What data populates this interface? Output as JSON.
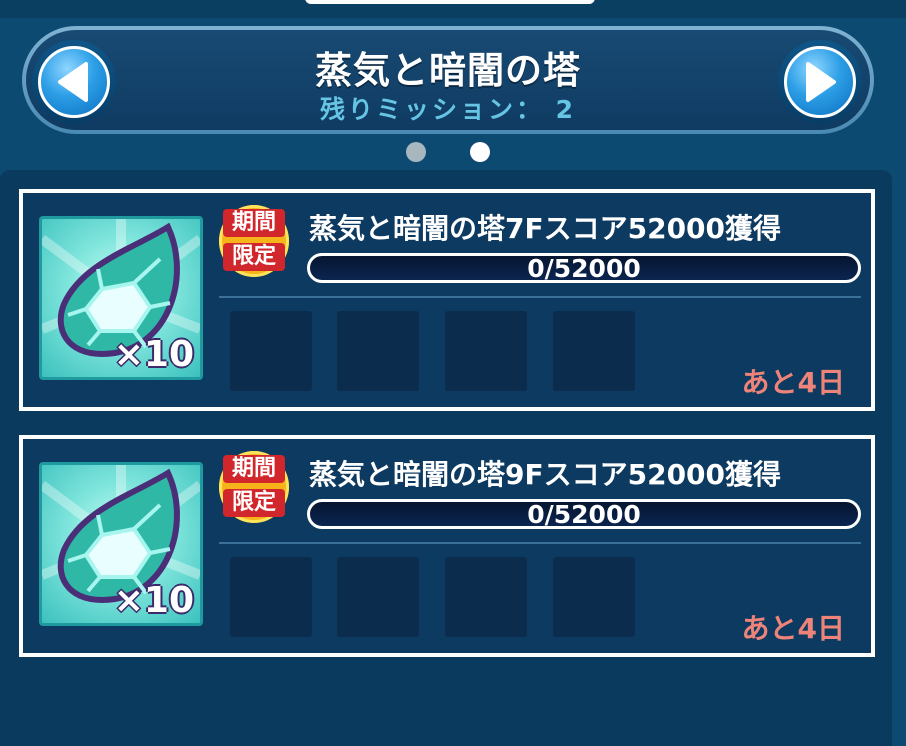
{
  "header": {
    "title": "蒸気と暗闇の塔",
    "subtitle": "残りミッション： 2",
    "prev_icon": "left-triangle-icon",
    "next_icon": "right-triangle-icon"
  },
  "pagination": {
    "pages": 2,
    "current": 2
  },
  "missions": [
    {
      "badge_line1": "期間",
      "badge_line2": "限定",
      "text": "蒸気と暗闇の塔7Fスコア52000獲得",
      "progress_text": "0/52000",
      "progress": 0,
      "reward_icon": "leaf-gem-icon",
      "reward_count": "×10",
      "remaining": "あと4日"
    },
    {
      "badge_line1": "期間",
      "badge_line2": "限定",
      "text": "蒸気と暗闇の塔9Fスコア52000獲得",
      "progress_text": "0/52000",
      "progress": 0,
      "reward_icon": "leaf-gem-icon",
      "reward_count": "×10",
      "remaining": "あと4日"
    }
  ],
  "colors": {
    "background": "#0d4a72",
    "remaining_text": "#ee8479",
    "badge_red": "#d1272c",
    "badge_gold": "#f7b41a",
    "reward_bg": "#7fe5dc"
  }
}
